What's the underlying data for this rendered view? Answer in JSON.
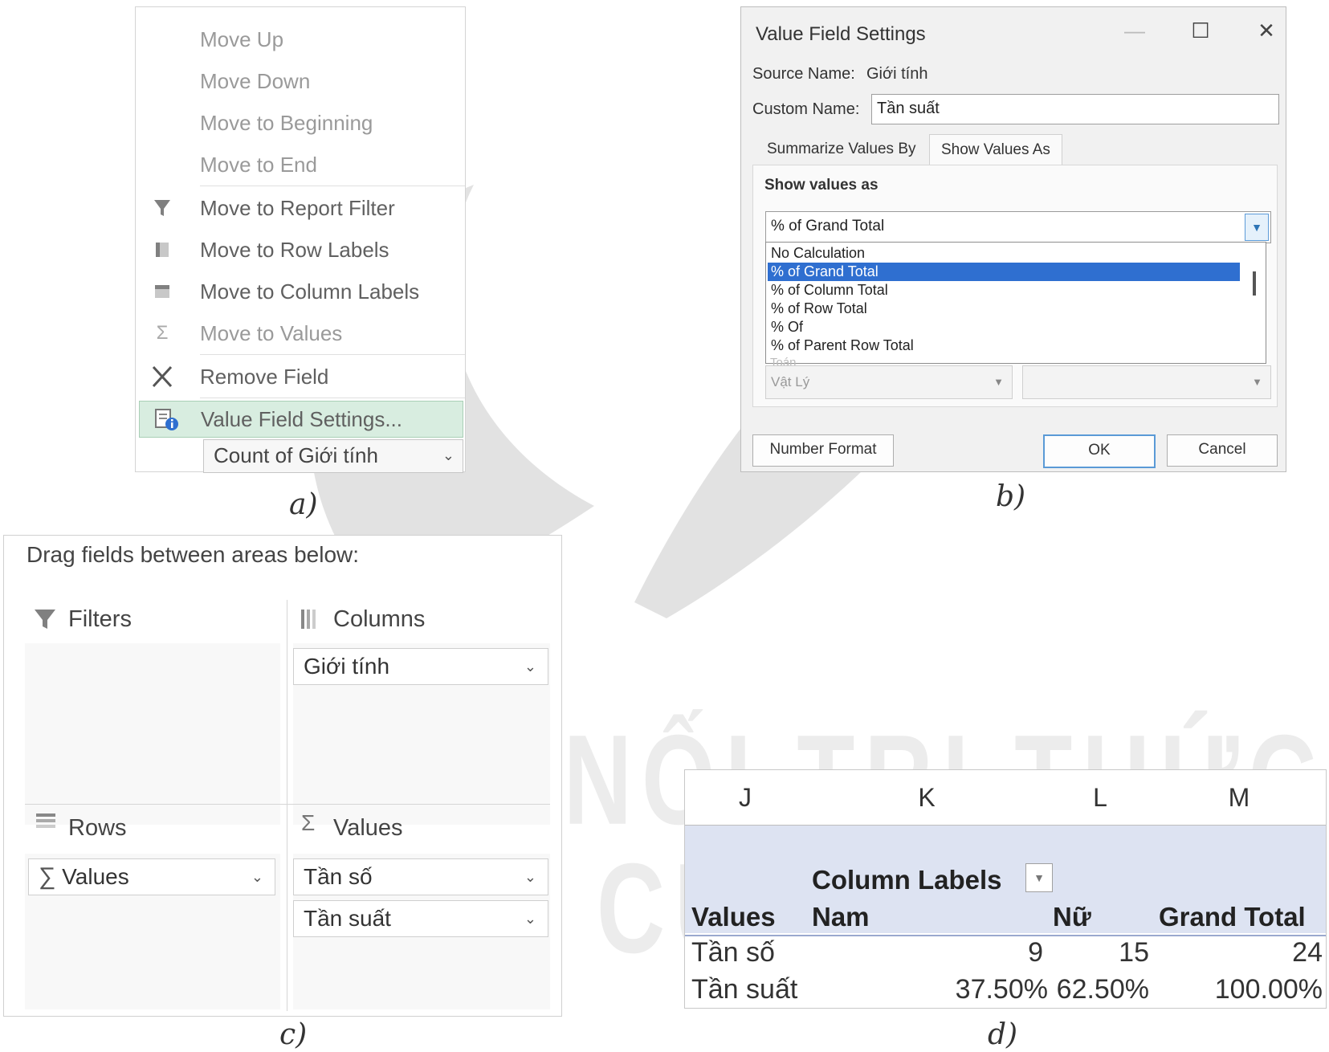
{
  "watermark": {
    "line1": "KẾT NỐI TRI THỨC",
    "line2": "VỚI CUỘC SỐNG"
  },
  "panel_a": {
    "caption": "a)",
    "menu": [
      {
        "label": "Move Up",
        "icon": "",
        "enabled": false
      },
      {
        "label": "Move Down",
        "icon": "",
        "enabled": false
      },
      {
        "label": "Move to Beginning",
        "icon": "",
        "enabled": false
      },
      {
        "label": "Move to End",
        "icon": "",
        "enabled": false
      },
      {
        "label": "Move to Report Filter",
        "icon": "filter-icon",
        "enabled": true
      },
      {
        "label": "Move to Row Labels",
        "icon": "row-labels-icon",
        "enabled": true
      },
      {
        "label": "Move to Column Labels",
        "icon": "column-labels-icon",
        "enabled": true
      },
      {
        "label": "Move to Values",
        "icon": "sigma-icon",
        "enabled": false
      },
      {
        "label": "Remove Field",
        "icon": "close-icon",
        "enabled": true
      },
      {
        "label": "Value Field Settings...",
        "icon": "field-settings-icon",
        "enabled": true,
        "highlighted": true
      }
    ],
    "field_chip": "Count of Giới tính"
  },
  "panel_b": {
    "caption": "b)",
    "title": "Value Field Settings",
    "source_name_label": "Source Name:",
    "source_name_value": "Giới tính",
    "custom_name_label": "Custom Name:",
    "custom_name_value": "Tần suất",
    "tabs": [
      "Summarize Values By",
      "Show Values As"
    ],
    "active_tab": "Show Values As",
    "show_values_label": "Show values as",
    "selected_option": "% of Grand Total",
    "options": [
      "No Calculation",
      "% of Grand Total",
      "% of Column Total",
      "% of Row Total",
      "% Of",
      "% of Parent Row Total"
    ],
    "base_field_partial": "Toán",
    "base_field_value": "Vật Lý",
    "number_format_button": "Number Format",
    "ok_button": "OK",
    "cancel_button": "Cancel"
  },
  "panel_c": {
    "caption": "c)",
    "header": "Drag fields between areas below:",
    "areas": {
      "filters": {
        "title": "Filters",
        "fields": []
      },
      "columns": {
        "title": "Columns",
        "fields": [
          "Giới tính"
        ]
      },
      "rows": {
        "title": "Rows",
        "fields": [
          "Values"
        ]
      },
      "values": {
        "title": "Values",
        "fields": [
          "Tần số",
          "Tần suất"
        ]
      }
    }
  },
  "panel_d": {
    "caption": "d)",
    "column_headers": [
      "J",
      "K",
      "L",
      "M"
    ],
    "column_labels": "Column Labels",
    "values_label": "Values",
    "col_nam": "Nam",
    "col_nu": "Nữ",
    "col_total": "Grand Total",
    "rows": [
      {
        "label": "Tần số",
        "nam": "9",
        "nu": "15",
        "total": "24"
      },
      {
        "label": "Tần suất",
        "nam": "37.50%",
        "nu": "62.50%",
        "total": "100.00%"
      }
    ]
  }
}
